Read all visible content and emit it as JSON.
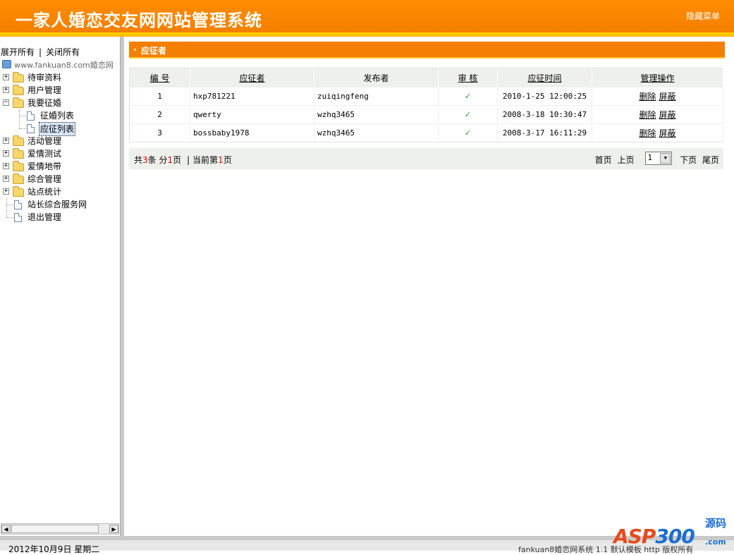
{
  "header": {
    "title": "一家人婚恋交友网网站管理系统",
    "hide_menu": "隐藏菜单"
  },
  "tree": {
    "expand_all": "展开所有",
    "separator": "|",
    "collapse_all": "关闭所有",
    "root_label": "www.fankuan8.com婚恋网",
    "items": [
      {
        "label": "待审资料",
        "expander": "+"
      },
      {
        "label": "用户管理",
        "expander": "+"
      },
      {
        "label": "我要征婚",
        "expander": "−"
      },
      {
        "label": "征婚列表"
      },
      {
        "label": "应征列表"
      },
      {
        "label": "活动管理",
        "expander": "+"
      },
      {
        "label": "爱情测试",
        "expander": "+"
      },
      {
        "label": "爱情地带",
        "expander": "+"
      },
      {
        "label": "综合管理",
        "expander": "+"
      },
      {
        "label": "站点统计",
        "expander": "+"
      },
      {
        "label": "站长综合服务网"
      },
      {
        "label": "退出管理"
      }
    ]
  },
  "section": {
    "title": "应征者"
  },
  "table": {
    "headers": [
      "编 号",
      "应征者",
      "发布者",
      "审 核",
      "应征时间",
      "管理操作"
    ],
    "rows": [
      {
        "id": "1",
        "applicant": "hxp781221",
        "publisher": "zuiqingfeng",
        "audit": "✓",
        "time": "2010-1-25 12:00:25",
        "delete": "删除",
        "block": "屏蔽"
      },
      {
        "id": "2",
        "applicant": "qwerty",
        "publisher": "wzhq3465",
        "audit": "✓",
        "time": "2008-3-18 10:30:47",
        "delete": "删除",
        "block": "屏蔽"
      },
      {
        "id": "3",
        "applicant": "bossbaby1978",
        "publisher": "wzhq3465",
        "audit": "✓",
        "time": "2008-3-17 16:11:29",
        "delete": "删除",
        "block": "屏蔽"
      }
    ]
  },
  "pager": {
    "total_prefix": "共",
    "total_count": "3",
    "total_suffix": "条",
    "pages_prefix": "分",
    "pages_count": "1",
    "pages_suffix": "页",
    "divider": "|",
    "current_prefix": "当前第",
    "current_page": "1",
    "current_suffix": "页",
    "first": "首页",
    "prev": "上页",
    "select_value": "1",
    "next": "下页",
    "last": "尾页"
  },
  "footer": {
    "date": "2012年10月9日  星期二",
    "copyright": "fankuan8婚恋网系统 1.1  默认模板 http  版权所有"
  },
  "watermark": {
    "brand": "ASP300",
    "brand_a": "ASP",
    "brand_b": "300",
    "tag": "源码",
    "domain": ".com"
  },
  "colors": {
    "header": "#f57f00",
    "stripe": "#ffc800",
    "accent_red": "#e00000",
    "check": "#2a9a2a"
  }
}
